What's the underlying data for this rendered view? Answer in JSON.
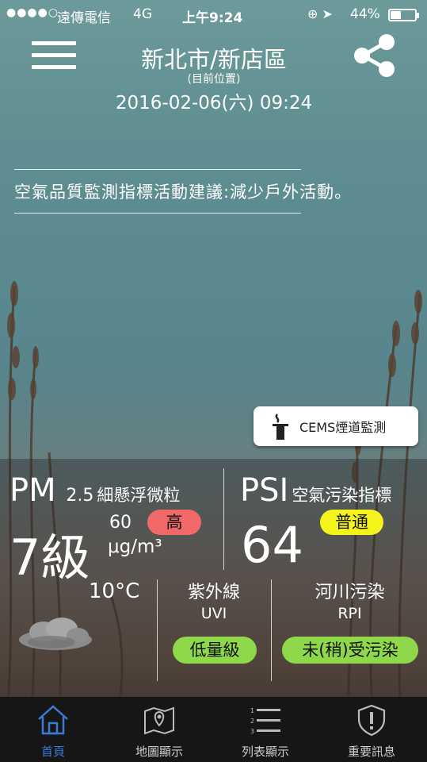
{
  "status_bar": {
    "signal": "●●●●○",
    "carrier": "遠傳電信",
    "network": "4G",
    "time": "上午9:24",
    "icons": "⊕ ➤",
    "battery_pct_label": "44%",
    "battery_level": 0.44
  },
  "header": {
    "location": "新北市/新店區",
    "location_note": "(目前位置)",
    "datetime": "2016-02-06(六) 09:24",
    "menu_icon": "hamburger-menu-icon",
    "share_icon": "share-icon"
  },
  "advice": "空氣品質監測指標活動建議:減少戶外活動。",
  "cems_button": {
    "label": "CEMS煙道監測",
    "icon": "chimney-icon"
  },
  "pm25": {
    "title_main": "PM",
    "title_sub": "2.5",
    "title_desc": "細懸浮微粒",
    "level": "7級",
    "value": "60",
    "unit": "μg/m³",
    "status": "高",
    "status_color": "#f06868"
  },
  "psi": {
    "title_main": "PSI",
    "title_desc": "空氣污染指標",
    "status": "普通",
    "status_color": "#f4f41c",
    "value": "64"
  },
  "weather": {
    "temperature": "10°C",
    "icon": "cloud-icon"
  },
  "uvi": {
    "title": "紫外線",
    "sub": "UVI",
    "status": "低量級"
  },
  "rpi": {
    "title": "河川污染",
    "sub": "RPI",
    "status": "未(稍)受污染"
  },
  "tabs": [
    {
      "label": "首頁",
      "icon": "home-icon",
      "active": true
    },
    {
      "label": "地圖顯示",
      "icon": "map-icon",
      "active": false
    },
    {
      "label": "列表顯示",
      "icon": "list-icon",
      "active": false
    },
    {
      "label": "重要訊息",
      "icon": "shield-alert-icon",
      "active": false
    }
  ],
  "colors": {
    "accent": "#3a7bd5",
    "green_badge": "#8ed84a",
    "tabbar": "#161616"
  }
}
